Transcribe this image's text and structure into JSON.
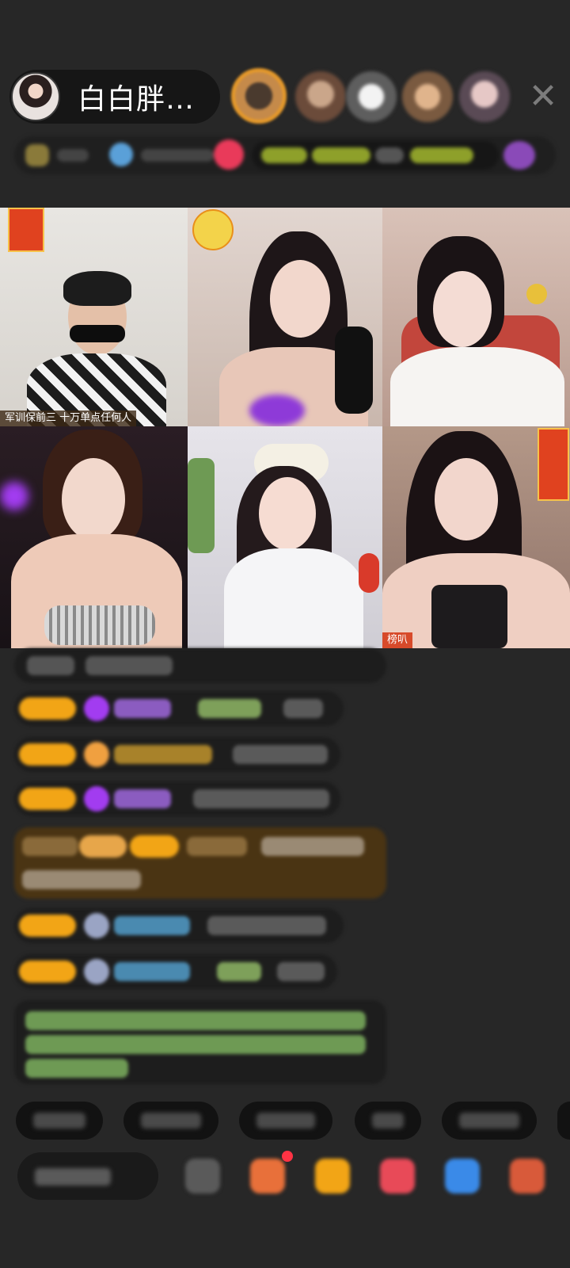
{
  "header": {
    "host_name": "白白胖…",
    "close_label": "✕",
    "icons": {
      "host_avatar": "host-avatar",
      "viewers": [
        "viewer-avatar",
        "viewer-avatar",
        "viewer-avatar",
        "viewer-avatar",
        "viewer-avatar"
      ],
      "close": "close-icon"
    }
  },
  "video_grid": {
    "tiles": [
      {
        "caption": "军训保前三  十万单点任何人"
      },
      {
        "caption": ""
      },
      {
        "caption": ""
      },
      {
        "caption": ""
      },
      {
        "caption": ""
      },
      {
        "caption": "榜叭"
      }
    ]
  },
  "colors": {
    "background": "#272727",
    "tag_gold": "#f2a516",
    "accent_purple": "#a23cf0",
    "chat_green": "#8dd07a",
    "system_bubble": "#4a3413"
  }
}
